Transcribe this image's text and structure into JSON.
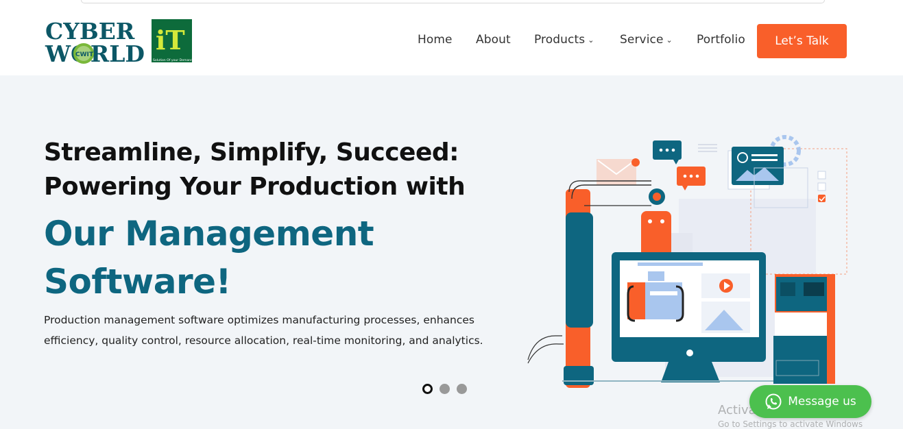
{
  "logo": {
    "line1": "CYBER",
    "line2": "WORLD",
    "badge": "iT",
    "tagline": "Solution Of your Demand",
    "mark": "CWIT"
  },
  "nav": {
    "items": [
      {
        "label": "Home"
      },
      {
        "label": "About"
      },
      {
        "label": "Products",
        "dropdown": true
      },
      {
        "label": "Service",
        "dropdown": true
      },
      {
        "label": "Portfolio"
      }
    ],
    "cta": "Let’s Talk"
  },
  "hero": {
    "title_line1": "Streamline, Simplify, Succeed:",
    "title_line2": "Powering Your Production with",
    "highlight_line1": "Our Management",
    "highlight_line2": "Software!",
    "description_line1": "Production management software optimizes manufacturing processes, enhances",
    "description_line2": "efficiency, quality control, resource allocation, real-time monitoring, and analytics.",
    "slides": 3,
    "active_slide": 1
  },
  "chat_widget": {
    "label": "Message us",
    "icon": "whatsapp-icon"
  },
  "watermark": {
    "line1": "Activate Windows",
    "line2": "Go to Settings to activate Windows"
  },
  "colors": {
    "accent": "#f95f2a",
    "brand_teal": "#0e6680",
    "whatsapp": "#4cc04e"
  }
}
